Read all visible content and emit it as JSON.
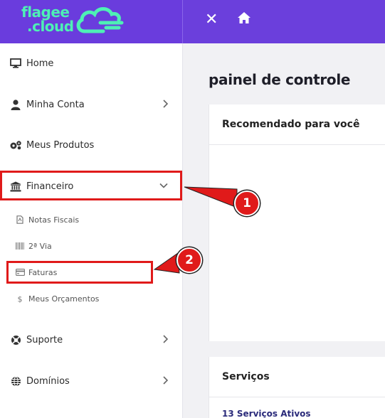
{
  "brand": {
    "line1": "flagee",
    "line2": ".cloud"
  },
  "topbar": {
    "close_glyph": "✕"
  },
  "sidebar": {
    "items": [
      {
        "label": "Home",
        "icon": "monitor-icon"
      },
      {
        "label": "Minha Conta",
        "icon": "user-icon"
      },
      {
        "label": "Meus Produtos",
        "icon": "gears-icon"
      },
      {
        "label": "Financeiro",
        "icon": "bank-icon"
      },
      {
        "label": "Suporte",
        "icon": "lifebuoy-icon"
      },
      {
        "label": "Domínios",
        "icon": "globe-icon"
      }
    ],
    "subitems": [
      {
        "label": "Notas Fiscais",
        "icon": "pdf-file-icon"
      },
      {
        "label": "2ª Via",
        "icon": "barcode-icon"
      },
      {
        "label": "Faturas",
        "icon": "credit-card-icon"
      },
      {
        "label": "Meus Orçamentos",
        "icon": "dollar-icon"
      }
    ]
  },
  "main": {
    "title": "painel de controle",
    "recommended_title": "Recomendado para você",
    "services_title": "Serviços",
    "services_link": "13 Serviços Ativos"
  },
  "callouts": {
    "one": "1",
    "two": "2"
  },
  "colors": {
    "brand_purple": "#6b3fdc",
    "brand_green": "#4ef0b5",
    "highlight_red": "#e01a1a"
  }
}
